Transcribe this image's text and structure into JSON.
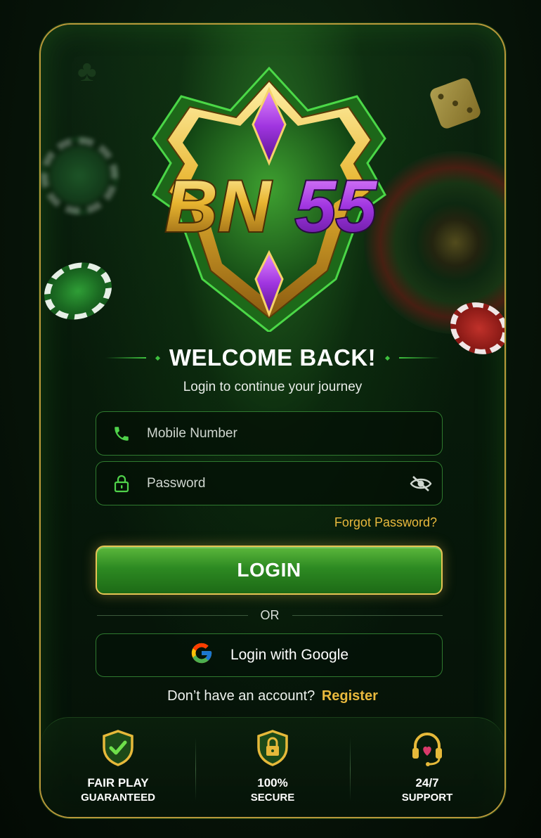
{
  "welcome": {
    "title": "WELCOME BACK!",
    "subtitle": "Login to continue your journey"
  },
  "logo": {
    "text_left": "BN",
    "text_right": "55"
  },
  "form": {
    "mobile_placeholder": "Mobile Number",
    "password_placeholder": "Password",
    "forgot_label": "Forgot Password?",
    "login_label": "LOGIN",
    "or_label": "OR",
    "google_label": "Login with Google"
  },
  "register": {
    "prompt": "Don’t have an account?",
    "link_label": "Register"
  },
  "features": [
    {
      "title": "FAIR PLAY",
      "subtitle": "GUARANTEED",
      "icon": "shield-check-icon"
    },
    {
      "title": "100%",
      "subtitle": "SECURE",
      "icon": "shield-lock-icon"
    },
    {
      "title": "24/7",
      "subtitle": "SUPPORT",
      "icon": "headset-icon"
    }
  ],
  "colors": {
    "accent_gold": "#e9b93d",
    "primary_green": "#2d8a22",
    "logo_purple": "#9b2fd6"
  }
}
